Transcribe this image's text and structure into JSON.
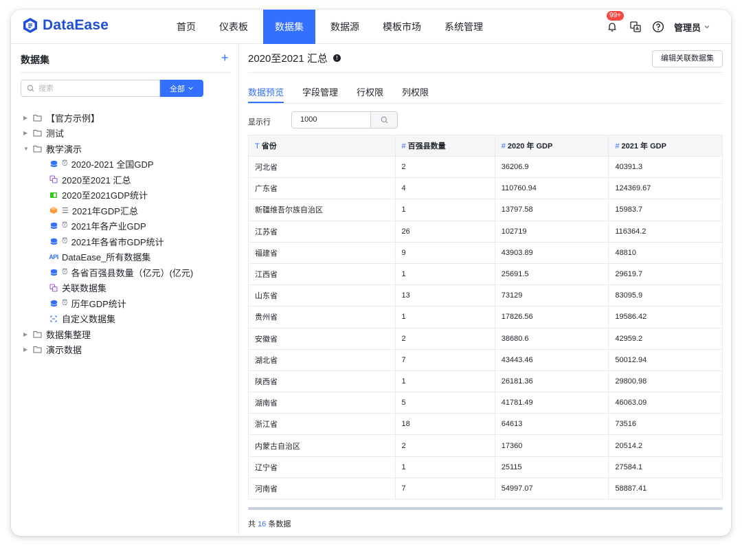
{
  "app": {
    "logo_text": "DataEase"
  },
  "nav": {
    "items": [
      "首页",
      "仪表板",
      "数据集",
      "数据源",
      "模板市场",
      "系统管理"
    ],
    "active": "数据集"
  },
  "header": {
    "notification_badge": "99+",
    "user_label": "管理员"
  },
  "sidebar": {
    "title": "数据集",
    "add_label": "+",
    "search_placeholder": "搜索",
    "filter_label": "全部",
    "tree": [
      {
        "type": "folder",
        "label": "【官方示例】",
        "expanded": false
      },
      {
        "type": "folder",
        "label": "测试",
        "expanded": false
      },
      {
        "type": "folder",
        "label": "教学演示",
        "expanded": true
      },
      {
        "type": "leaf",
        "label": "2020-2021 全国GDP",
        "icon": "database-icon",
        "color": "#3370ff",
        "clock": true
      },
      {
        "type": "leaf",
        "label": "2020至2021 汇总",
        "icon": "union-icon",
        "color": "#9b59e6",
        "clock": false
      },
      {
        "type": "leaf",
        "label": "2020至2021GDP统计",
        "icon": "excel-icon",
        "color": "#34c724",
        "clock": false
      },
      {
        "type": "leaf",
        "label": "2021年GDP汇总",
        "icon": "cube-icon",
        "color": "#ff9a2e",
        "clock": false,
        "lines": true
      },
      {
        "type": "leaf",
        "label": "2021年各产业GDP",
        "icon": "database-icon",
        "color": "#3370ff",
        "clock": true
      },
      {
        "type": "leaf",
        "label": "2021年各省市GDP统计",
        "icon": "database-icon",
        "color": "#3370ff",
        "clock": true
      },
      {
        "type": "leaf",
        "label": "DataEase_所有数据集",
        "icon": "api-icon",
        "color": "#3370ff",
        "clock": false
      },
      {
        "type": "leaf",
        "label": "各省百强县数量（亿元）(亿元)",
        "icon": "database-icon",
        "color": "#3370ff",
        "clock": true
      },
      {
        "type": "leaf",
        "label": "关联数据集",
        "icon": "union-icon",
        "color": "#9b59e6",
        "clock": false
      },
      {
        "type": "leaf",
        "label": "历年GDP统计",
        "icon": "database-icon",
        "color": "#3370ff",
        "clock": true
      },
      {
        "type": "leaf",
        "label": "自定义数据集",
        "icon": "custom-icon",
        "color": "#3370ff",
        "clock": false
      },
      {
        "type": "folder",
        "label": "数据集整理",
        "expanded": false
      },
      {
        "type": "folder",
        "label": "演示数据",
        "expanded": false
      }
    ]
  },
  "main": {
    "title": "2020至2021 汇总",
    "edit_button": "编辑关联数据集",
    "tabs": [
      "数据预览",
      "字段管理",
      "行权限",
      "列权限"
    ],
    "active_tab": "数据预览",
    "rows_label": "显示行",
    "rows_value": "1000",
    "columns": [
      {
        "icon": "T",
        "label": "省份"
      },
      {
        "icon": "#",
        "label": "百强县数量"
      },
      {
        "icon": "#",
        "label": "2020 年 GDP"
      },
      {
        "icon": "#",
        "label": "2021 年 GDP"
      }
    ],
    "rows": [
      [
        "河北省",
        "2",
        "36206.9",
        "40391.3"
      ],
      [
        "广东省",
        "4",
        "110760.94",
        "124369.67"
      ],
      [
        "新疆维吾尔族自治区",
        "1",
        "13797.58",
        "15983.7"
      ],
      [
        "江苏省",
        "26",
        "102719",
        "116364.2"
      ],
      [
        "福建省",
        "9",
        "43903.89",
        "48810"
      ],
      [
        "江西省",
        "1",
        "25691.5",
        "29619.7"
      ],
      [
        "山东省",
        "13",
        "73129",
        "83095.9"
      ],
      [
        "贵州省",
        "1",
        "17826.56",
        "19586.42"
      ],
      [
        "安徽省",
        "2",
        "38680.6",
        "42959.2"
      ],
      [
        "湖北省",
        "7",
        "43443.46",
        "50012.94"
      ],
      [
        "陕西省",
        "1",
        "26181.36",
        "29800.98"
      ],
      [
        "湖南省",
        "5",
        "41781.49",
        "46063.09"
      ],
      [
        "浙江省",
        "18",
        "64613",
        "73516"
      ],
      [
        "内蒙古自治区",
        "2",
        "17360",
        "20514.2"
      ],
      [
        "辽宁省",
        "1",
        "25115",
        "27584.1"
      ],
      [
        "河南省",
        "7",
        "54997.07",
        "58887.41"
      ]
    ],
    "total_prefix": "共",
    "total_count": "16",
    "total_suffix": "条数据"
  },
  "colors": {
    "accent": "#3370ff",
    "badge": "#f54a45"
  }
}
